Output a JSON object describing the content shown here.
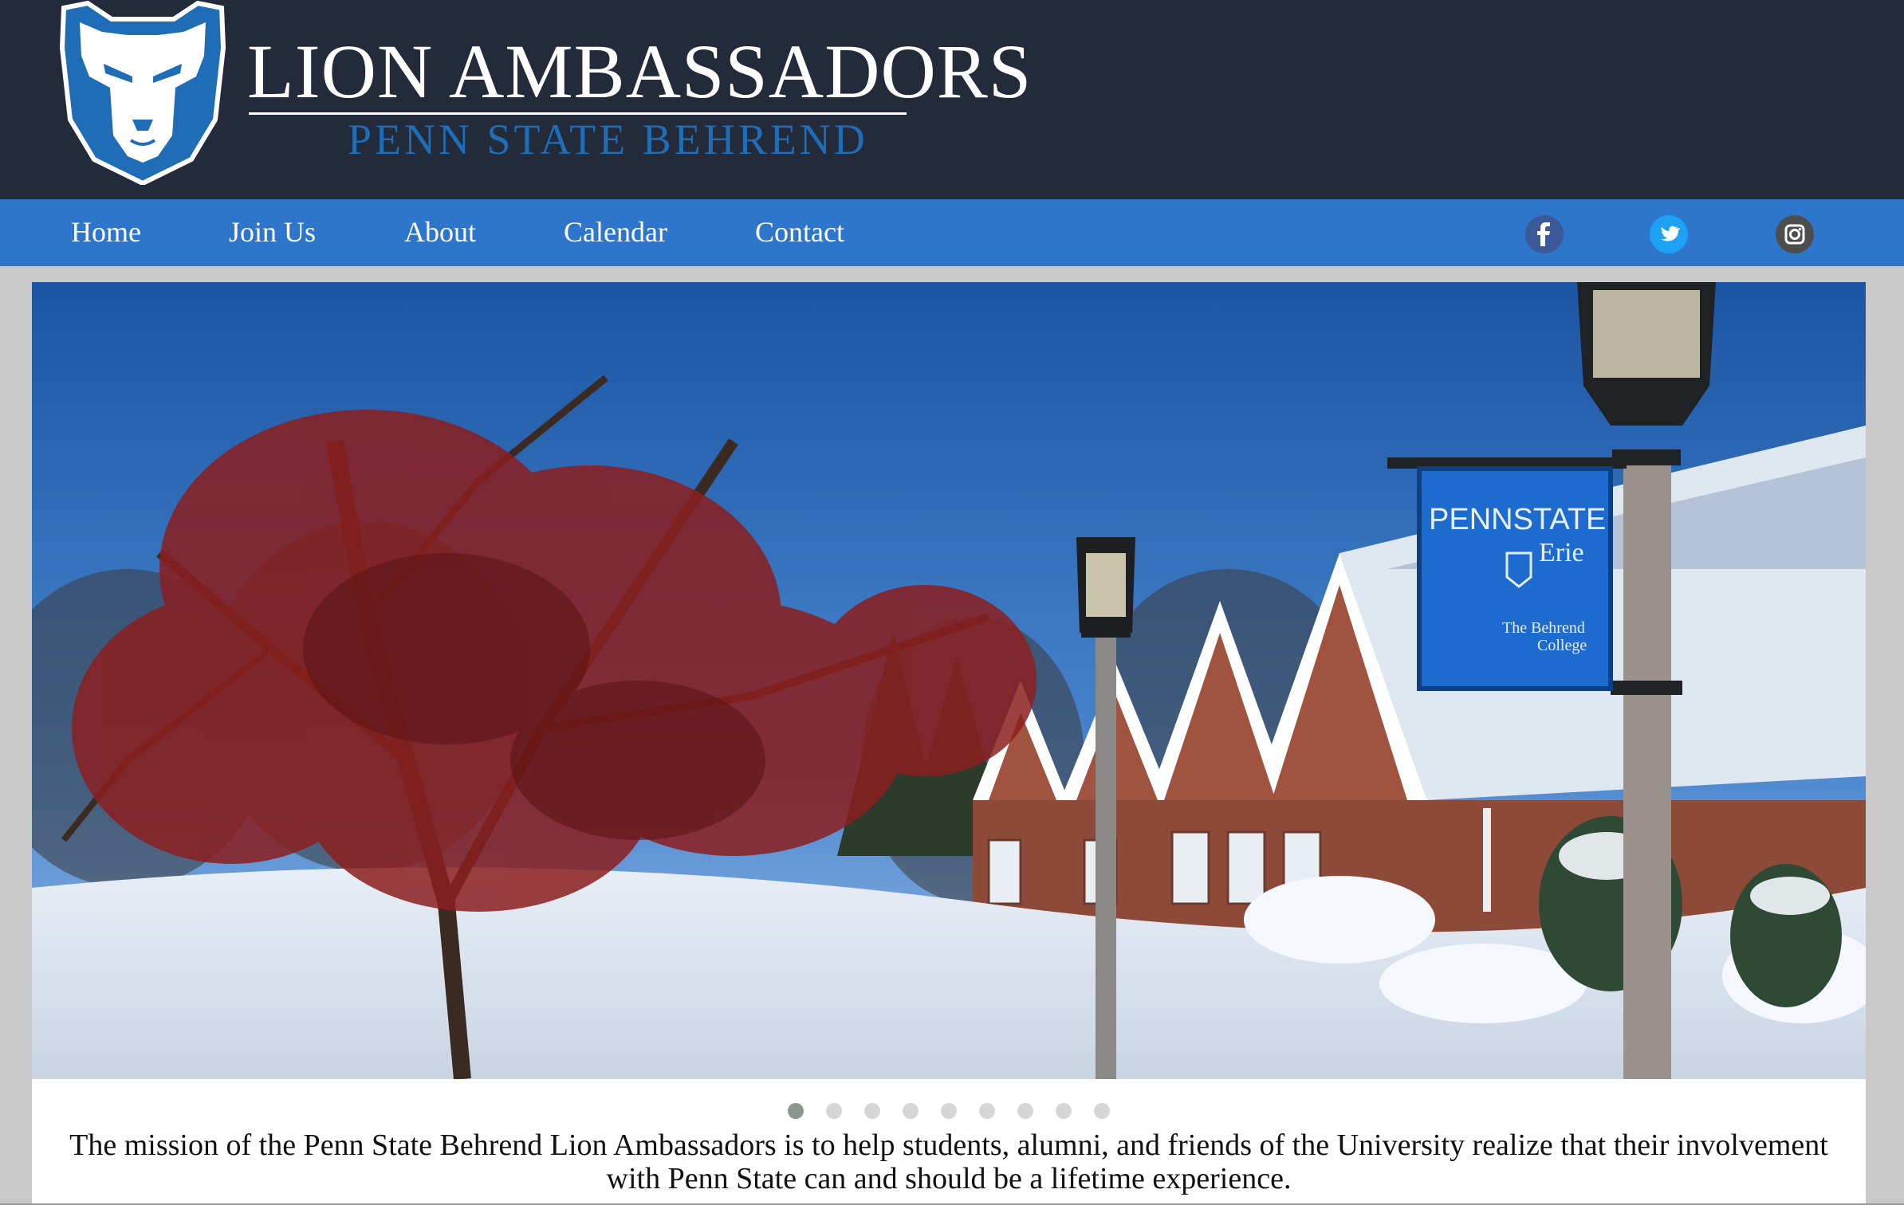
{
  "header": {
    "title": "LION AMBASSADORS",
    "subtitle": "PENN STATE BEHREND",
    "logo_icon": "nittany-lion-shield-icon",
    "brand_colors": {
      "dark": "#232a39",
      "blue": "#1f6db6",
      "nav": "#2e76cb"
    }
  },
  "nav": {
    "items": [
      {
        "label": "Home"
      },
      {
        "label": "Join Us"
      },
      {
        "label": "About"
      },
      {
        "label": "Calendar"
      },
      {
        "label": "Contact"
      }
    ],
    "social": [
      {
        "name": "facebook-icon",
        "glyph": "f",
        "color": "#3b5998"
      },
      {
        "name": "twitter-icon",
        "glyph": "bird",
        "color": "#1da1f2"
      },
      {
        "name": "instagram-icon",
        "glyph": "camera",
        "color": "#555555"
      }
    ]
  },
  "hero": {
    "sign_line1": "PENNSTATE",
    "sign_line2": "Erie",
    "sign_line3": "The Behrend",
    "sign_line4": "College",
    "slide_count": 9,
    "active_slide": 1
  },
  "mission": {
    "text": "The mission of the Penn State Behrend Lion Ambassadors is to help students, alumni, and friends of the University realize that their involvement with Penn State can and should be a lifetime experience."
  }
}
